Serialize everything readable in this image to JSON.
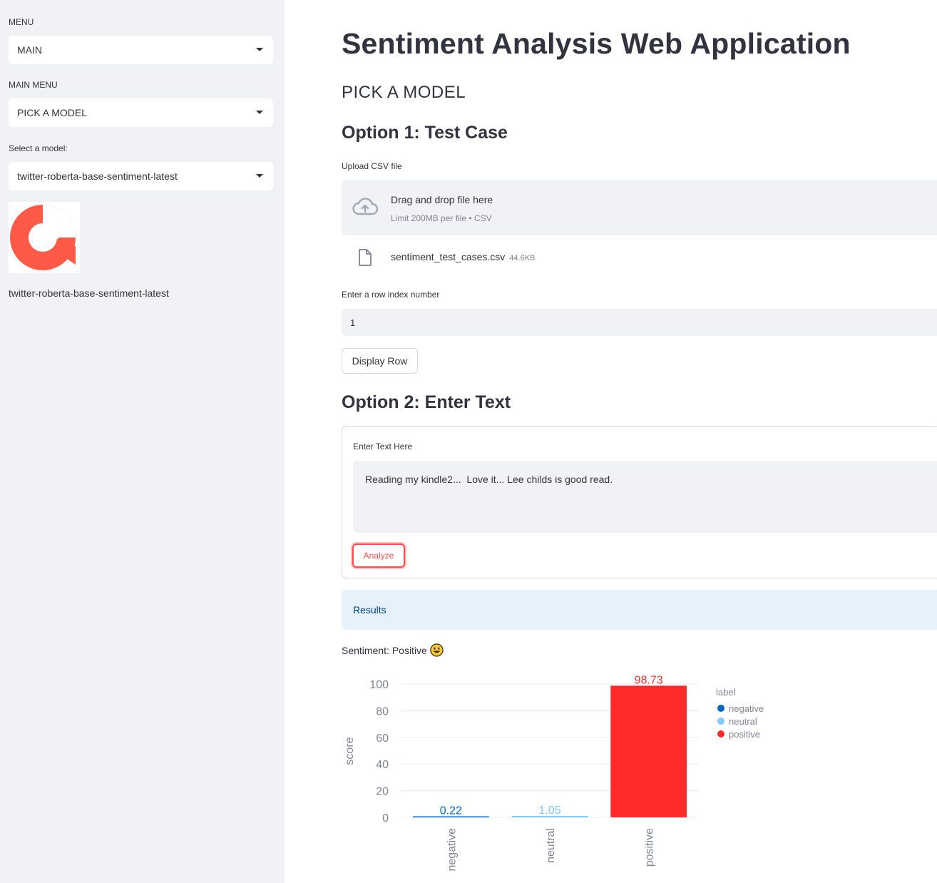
{
  "sidebar": {
    "menu_label": "MENU",
    "menu_value": "MAIN",
    "main_menu_label": "MAIN MENU",
    "main_menu_value": "PICK A MODEL",
    "model_label": "Select a model:",
    "model_value": "twitter-roberta-base-sentiment-latest",
    "logo_icon": "red-chat-bubble-logo",
    "caption": "twitter-roberta-base-sentiment-latest"
  },
  "main": {
    "title": "Sentiment Analysis Web Application",
    "section_heading": "PICK A MODEL",
    "option1_heading": "Option 1: Test Case",
    "upload_label": "Upload CSV file",
    "dropzone_text": "Drag and drop file here",
    "dropzone_limit": "Limit 200MB per file • CSV",
    "file_name": "sentiment_test_cases.csv",
    "file_size": "44.6KB",
    "row_label": "Enter a row index number",
    "row_value": "1",
    "display_button": "Display Row",
    "option2_heading": "Option 2: Enter Text",
    "text_label": "Enter Text Here",
    "text_value": "Reading my kindle2...  Love it... Lee childs is good read.",
    "analyze_button": "Analyze",
    "results_label": "Results",
    "sentiment_text": "Sentiment: Positive"
  },
  "colors": {
    "accent": "#ff4b4b",
    "negative": "#0068c9",
    "neutral": "#83c9ff",
    "positive": "#ff2b2b"
  },
  "chart_data": {
    "type": "bar",
    "categories": [
      "negative",
      "neutral",
      "positive"
    ],
    "values": [
      0.22,
      1.05,
      98.73
    ],
    "value_labels": [
      "0.22",
      "1.05",
      "98.73"
    ],
    "ylabel": "score",
    "xlabel": "",
    "ylim": [
      0,
      100
    ],
    "yticks": [
      "0",
      "20",
      "40",
      "60",
      "80",
      "100"
    ],
    "legend_title": "label",
    "legend": [
      "negative",
      "neutral",
      "positive"
    ],
    "legend_position": "right",
    "grid": true
  }
}
